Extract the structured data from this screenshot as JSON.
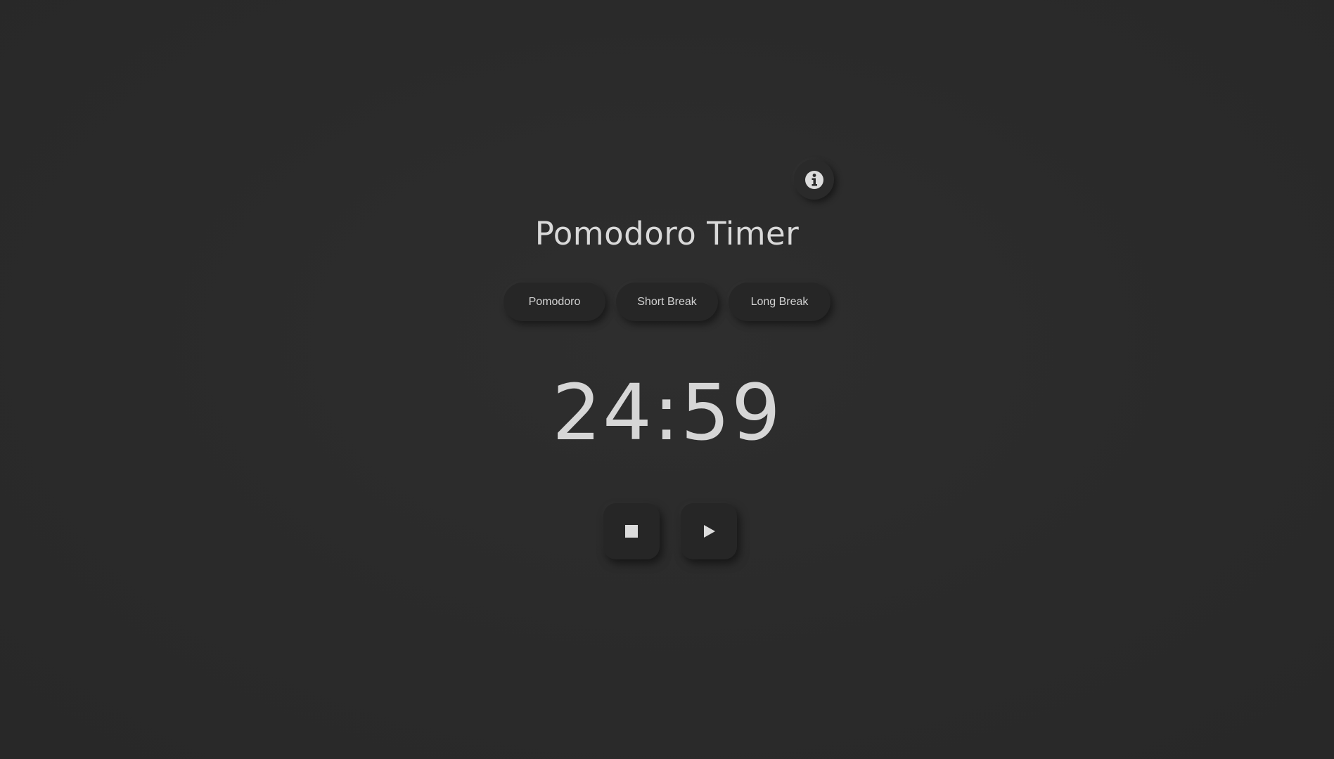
{
  "app": {
    "title": "Pomodoro Timer"
  },
  "info_button": {
    "icon": "info-icon"
  },
  "modes": [
    {
      "label": "Pomodoro"
    },
    {
      "label": "Short Break"
    },
    {
      "label": "Long Break"
    }
  ],
  "timer": {
    "display": "24:59"
  },
  "controls": {
    "stop_icon": "stop-icon",
    "play_icon": "play-icon"
  },
  "colors": {
    "background": "#2b2b2b",
    "surface": "#262626",
    "text": "#d6d6d6"
  }
}
